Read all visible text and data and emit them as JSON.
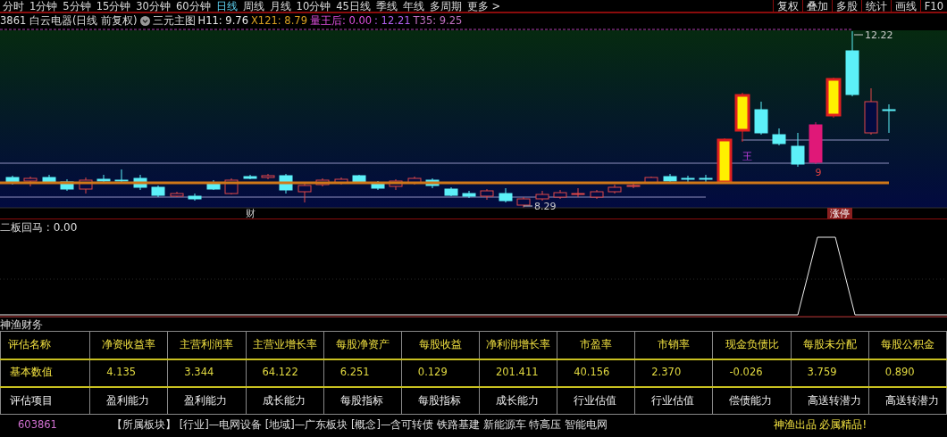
{
  "toolbar": {
    "tabs": [
      {
        "label": "分时",
        "selected": false
      },
      {
        "label": "1分钟",
        "selected": false
      },
      {
        "label": "5分钟",
        "selected": false
      },
      {
        "label": "15分钟",
        "selected": false
      },
      {
        "label": "30分钟",
        "selected": false
      },
      {
        "label": "60分钟",
        "selected": false
      },
      {
        "label": "日线",
        "selected": true
      },
      {
        "label": "周线",
        "selected": false
      },
      {
        "label": "月线",
        "selected": false
      },
      {
        "label": "10分钟",
        "selected": false
      },
      {
        "label": "45日线",
        "selected": false
      },
      {
        "label": "季线",
        "selected": false
      },
      {
        "label": "年线",
        "selected": false
      },
      {
        "label": "多周期",
        "selected": false
      },
      {
        "label": "更多 >",
        "selected": false
      }
    ],
    "buttons": [
      "复权",
      "叠加",
      "多股",
      "统计",
      "画线",
      "F10"
    ]
  },
  "info_bar": {
    "stock": "3861 白云电器(日线 前复权)",
    "template": "三元主图",
    "indicators": [
      "H11: 9.76",
      "X121: 8.79",
      "量王后: 0.00",
      ": 12.21",
      "T35: 9.25"
    ]
  },
  "price_chart": {
    "high_price": "12.22",
    "low_price": "8.29",
    "signal_marks": [
      "王",
      "9"
    ],
    "event_tags": [
      "财",
      "涨停"
    ]
  },
  "indicator_panel": {
    "title": "二板回马 : 0.00"
  },
  "finance": {
    "title": "神渔财务",
    "columns": [
      "评估名称",
      "净资收益率",
      "主营利润率",
      "主营业增长率",
      "每股净资产",
      "每股收益",
      "净利润增长率",
      "市盈率",
      "市销率",
      "现金负债比",
      "每股未分配",
      "每股公积金"
    ],
    "rows": [
      {
        "kind": "value",
        "cells": [
          "基本数值",
          "4.135",
          "3.344",
          "64.122",
          "6.251",
          "0.129",
          "201.411",
          "40.156",
          "2.370",
          "-0.026",
          "3.759",
          "0.890"
        ]
      },
      {
        "kind": "category",
        "cells": [
          "评估项目",
          "盈利能力",
          "盈利能力",
          "成长能力",
          "每股指标",
          "每股指标",
          "成长能力",
          "行业估值",
          "行业估值",
          "偿债能力",
          "高送转潜力",
          "高送转潜力"
        ]
      }
    ]
  },
  "footer": {
    "code": "603861",
    "sectors": "【所属板块】 [行业]—电网设备 [地域]—广东板块 [概念]—含可转债 铁路基建 新能源车 特高压 智能电网",
    "slogan": "神渔出品 必属精品!"
  }
}
